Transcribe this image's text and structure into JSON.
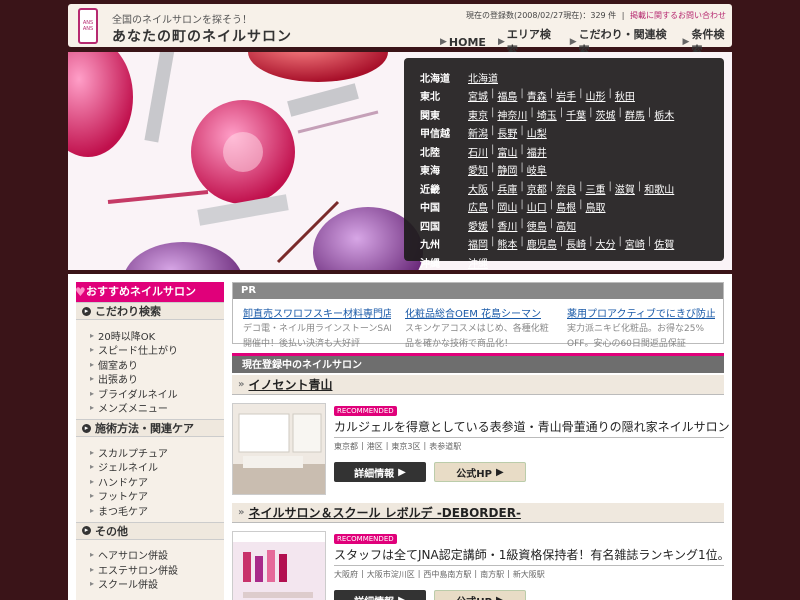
{
  "header": {
    "logo_lines": [
      "ANS",
      "ANS"
    ],
    "tagline": "全国のネイルサロンを探そう！",
    "site_name": "あなたの町のネイルサロン",
    "registration_count": "現在の登録数(2008/02/27現在)：329 件",
    "inquiry_link": "掲載に関するお問い合わせ",
    "nav": [
      "HOME",
      "エリア検索",
      "こだわり・関連検索",
      "条件検索"
    ]
  },
  "areas": [
    {
      "region": "北海道",
      "prefs": [
        "北海道"
      ]
    },
    {
      "region": "東北",
      "prefs": [
        "宮城",
        "福島",
        "青森",
        "岩手",
        "山形",
        "秋田"
      ]
    },
    {
      "region": "関東",
      "prefs": [
        "東京",
        "神奈川",
        "埼玉",
        "千葉",
        "茨城",
        "群馬",
        "栃木"
      ]
    },
    {
      "region": "甲信越",
      "prefs": [
        "新潟",
        "長野",
        "山梨"
      ]
    },
    {
      "region": "北陸",
      "prefs": [
        "石川",
        "富山",
        "福井"
      ]
    },
    {
      "region": "東海",
      "prefs": [
        "愛知",
        "静岡",
        "岐阜"
      ]
    },
    {
      "region": "近畿",
      "prefs": [
        "大阪",
        "兵庫",
        "京都",
        "奈良",
        "三重",
        "滋賀",
        "和歌山"
      ]
    },
    {
      "region": "中国",
      "prefs": [
        "広島",
        "岡山",
        "山口",
        "島根",
        "鳥取"
      ]
    },
    {
      "region": "四国",
      "prefs": [
        "愛媛",
        "香川",
        "徳島",
        "高知"
      ]
    },
    {
      "region": "九州",
      "prefs": [
        "福岡",
        "熊本",
        "鹿児島",
        "長崎",
        "大分",
        "宮崎",
        "佐賀"
      ]
    },
    {
      "region": "沖縄",
      "prefs": [
        "沖縄"
      ]
    }
  ],
  "sidebar": {
    "title": "おすすめネイルサロン",
    "sections": [
      {
        "heading": "こだわり検索",
        "items": [
          "20時以降OK",
          "スピード仕上がり",
          "個室あり",
          "出張あり",
          "ブライダルネイル",
          "メンズメニュー"
        ]
      },
      {
        "heading": "施術方法・関連ケア",
        "items": [
          "スカルプチュア",
          "ジェルネイル",
          "ハンドケア",
          "フットケア",
          "まつ毛ケア"
        ]
      },
      {
        "heading": "その他",
        "items": [
          "ヘアサロン併設",
          "エステサロン併設",
          "スクール併設"
        ]
      }
    ]
  },
  "pr": {
    "label": "PR",
    "items": [
      {
        "title": "卸直売スワロフスキー材料専門店",
        "desc1": "デコ電・ネイル用ラインストーンSALE",
        "desc2": "開催中！後払い決済も大好評"
      },
      {
        "title": "化粧品総合OEM 花島シーマン",
        "desc1": "スキンケアコスメはじめ、各種化粧",
        "desc2": "品を確かな技術で商品化！"
      },
      {
        "title": "薬用プロアクティブでにきび防止",
        "desc1": "実力派ニキビ化粧品。お得な25%",
        "desc2": "OFF。安心の60日間返品保証"
      }
    ]
  },
  "registered_heading": "現在登録中のネイルサロン",
  "salons": [
    {
      "name": "イノセント青山",
      "badge": "RECOMMENDED",
      "catch": "カルジェルを得意としている表参道・青山骨董通りの隠れ家ネイルサロン",
      "location": [
        "東京都",
        "港区",
        "東京3区",
        "表参道駅"
      ],
      "details_label": "詳細情報",
      "hp_label": "公式HP"
    },
    {
      "name": "ネイルサロン＆スクール レボルデ -DEBORDER-",
      "badge": "RECOMMENDED",
      "catch": "スタッフは全てJNA認定講師・1級資格保持者！有名雑誌ランキング1位。",
      "location": [
        "大阪府",
        "大阪市淀川区",
        "西中島南方駅",
        "南方駅",
        "新大阪駅"
      ],
      "details_label": "詳細情報",
      "hp_label": "公式HP"
    }
  ],
  "colors": {
    "accent": "#e0007a",
    "background": "#3a1418",
    "panel": "#f6f0e8"
  }
}
